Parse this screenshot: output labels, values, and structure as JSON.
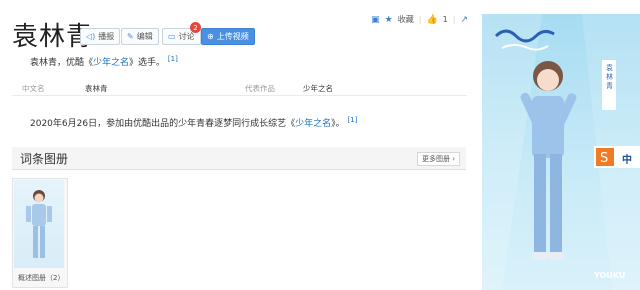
{
  "entry": {
    "title": "袁林青",
    "summary_prefix": "袁林青，优酷《",
    "summary_link": "少年之名",
    "summary_suffix": "》选手。",
    "ref1": "[1]"
  },
  "toolbar": {
    "play_label": "播报",
    "edit_label": "编辑",
    "discuss_label": "讨论",
    "discuss_badge": "2",
    "upload_label": "上传视频"
  },
  "top_actions": {
    "collect_label": "收藏",
    "like_count": "1"
  },
  "info": {
    "chinese_name_key": "中文名",
    "chinese_name_val": "袁林青",
    "works_key": "代表作品",
    "works_val": "少年之名"
  },
  "body": {
    "text_prefix": "2020年6月26日，参加由优酷出品的少年青春逐梦同行成长综艺《",
    "text_link": "少年之名",
    "text_suffix": "》。",
    "ref": "[1]"
  },
  "gallery": {
    "section_title": "词条图册",
    "more_label": "更多图册",
    "album_label": "概述图册（2）"
  },
  "poster": {
    "side_text": "袁林青",
    "badge_text": "中",
    "youku_text": "YOUKU"
  },
  "colors": {
    "link": "#136ec2",
    "primary_button": "#4a90e2",
    "badge": "#e7473b",
    "poster_sky": "#a7dcf2"
  }
}
